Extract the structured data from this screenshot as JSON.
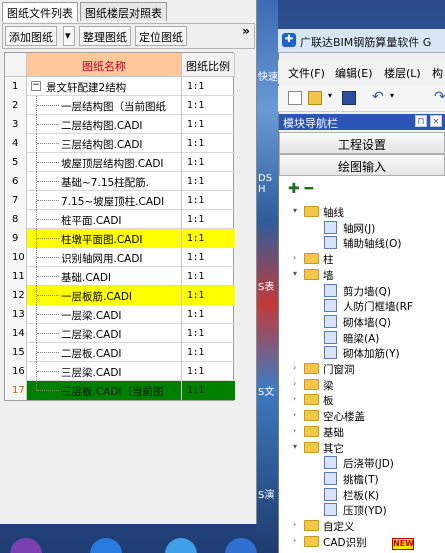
{
  "left_panel": {
    "tabs": [
      "图纸文件列表",
      "图纸楼层对照表"
    ],
    "toolbar": {
      "add": "添加图纸",
      "dropdown": "▾",
      "organize": "整理图纸",
      "locate": "定位图纸",
      "more": "»"
    },
    "columns": {
      "name": "图纸名称",
      "ratio": "图纸比例"
    },
    "rows": [
      {
        "n": "1",
        "name": "景文轩配建2结构",
        "ratio": "1:1"
      },
      {
        "n": "2",
        "name": "一层结构图（当前图纸",
        "ratio": "1:1"
      },
      {
        "n": "3",
        "name": "二层结构图.CADI",
        "ratio": "1:1"
      },
      {
        "n": "4",
        "name": "三层结构图.CADI",
        "ratio": "1:1"
      },
      {
        "n": "5",
        "name": "坡屋顶层结构图.CADI",
        "ratio": "1:1"
      },
      {
        "n": "6",
        "name": "基础~7.15柱配筋.",
        "ratio": "1:1"
      },
      {
        "n": "7",
        "name": "7.15~坡屋顶柱.CADI",
        "ratio": "1:1"
      },
      {
        "n": "8",
        "name": "桩平面.CADI",
        "ratio": "1:1"
      },
      {
        "n": "9",
        "name": "柱墩平面图.CADI",
        "ratio": "1:1"
      },
      {
        "n": "10",
        "name": "识别轴网用.CADI",
        "ratio": "1:1"
      },
      {
        "n": "11",
        "name": "基础.CADI",
        "ratio": "1:1"
      },
      {
        "n": "12",
        "name": "一层板筋.CADI",
        "ratio": "1:1"
      },
      {
        "n": "13",
        "name": "一层梁.CADI",
        "ratio": "1:1"
      },
      {
        "n": "14",
        "name": "二层梁.CADI",
        "ratio": "1:1"
      },
      {
        "n": "15",
        "name": "二层板.CADI",
        "ratio": "1:1"
      },
      {
        "n": "16",
        "name": "三层梁.CADI",
        "ratio": "1:1"
      },
      {
        "n": "17",
        "name": "三层板.CADI（当前图",
        "ratio": "1:1"
      }
    ],
    "root_expander": "−"
  },
  "desktop": {
    "labels": [
      "快速",
      "DS H",
      "S表",
      "S文",
      "S演"
    ]
  },
  "right_panel": {
    "title": "广联达BIM钢筋算量软件 G",
    "menus": [
      "文件(F)",
      "编辑(E)",
      "楼层(L)",
      "构"
    ],
    "nav_title": "模块导航栏",
    "pin": "⊓",
    "close": "×",
    "sections": [
      "工程设置",
      "绘图输入"
    ],
    "tree_tools": "✚ ━",
    "tree": [
      {
        "level": 1,
        "toggle": "▾",
        "type": "folder",
        "label": "轴线"
      },
      {
        "level": 2,
        "toggle": "",
        "type": "item",
        "label": "轴网(J)"
      },
      {
        "level": 2,
        "toggle": "",
        "type": "item",
        "label": "辅助轴线(O)"
      },
      {
        "level": 1,
        "toggle": "›",
        "type": "folder",
        "label": "柱"
      },
      {
        "level": 1,
        "toggle": "▾",
        "type": "folder",
        "label": "墙"
      },
      {
        "level": 2,
        "toggle": "",
        "type": "item",
        "label": "剪力墙(Q)"
      },
      {
        "level": 2,
        "toggle": "",
        "type": "item",
        "label": "人防门框墙(RF"
      },
      {
        "level": 2,
        "toggle": "",
        "type": "item",
        "label": "砌体墙(Q)"
      },
      {
        "level": 2,
        "toggle": "",
        "type": "item",
        "label": "暗梁(A)"
      },
      {
        "level": 2,
        "toggle": "",
        "type": "item",
        "label": "砌体加筋(Y)"
      },
      {
        "level": 1,
        "toggle": "›",
        "type": "folder",
        "label": "门窗洞"
      },
      {
        "level": 1,
        "toggle": "›",
        "type": "folder",
        "label": "梁"
      },
      {
        "level": 1,
        "toggle": "›",
        "type": "folder",
        "label": "板"
      },
      {
        "level": 1,
        "toggle": "›",
        "type": "folder",
        "label": "空心楼盖"
      },
      {
        "level": 1,
        "toggle": "›",
        "type": "folder",
        "label": "基础"
      },
      {
        "level": 1,
        "toggle": "▾",
        "type": "folder",
        "label": "其它"
      },
      {
        "level": 2,
        "toggle": "",
        "type": "item",
        "label": "后浇带(JD)"
      },
      {
        "level": 2,
        "toggle": "",
        "type": "item",
        "label": "挑檐(T)"
      },
      {
        "level": 2,
        "toggle": "",
        "type": "item",
        "label": "栏板(K)"
      },
      {
        "level": 2,
        "toggle": "",
        "type": "item",
        "label": "压顶(YD)"
      },
      {
        "level": 1,
        "toggle": "›",
        "type": "folder",
        "label": "自定义"
      },
      {
        "level": 1,
        "toggle": "›",
        "type": "folder",
        "label": "CAD识别"
      }
    ],
    "new_badge": "NEW"
  },
  "colors": {
    "highlight_yellow": "#ffff00",
    "selected_green": "#008000",
    "nav_blue": "#2a56b5",
    "header_orange": "#ffc79a"
  }
}
